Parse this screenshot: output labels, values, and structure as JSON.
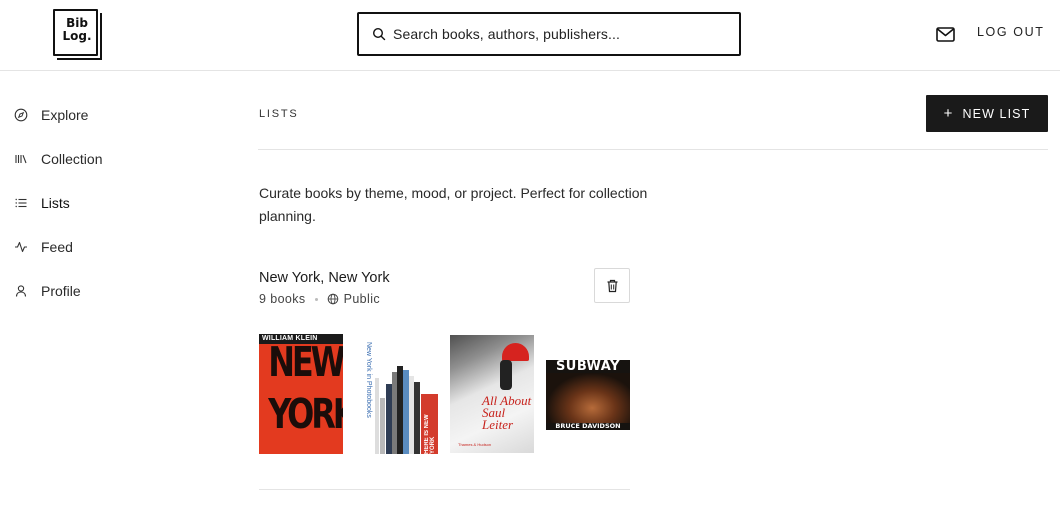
{
  "header": {
    "logo_line1": "Bib",
    "logo_line2": "Log.",
    "search_placeholder": "Search books, authors, publishers...",
    "messages_icon": "mail-icon",
    "logout_label": "LOG OUT"
  },
  "sidebar": {
    "items": [
      {
        "label": "Explore",
        "icon": "compass-icon"
      },
      {
        "label": "Collection",
        "icon": "library-icon"
      },
      {
        "label": "Lists",
        "icon": "list-icon",
        "active": true
      },
      {
        "label": "Feed",
        "icon": "activity-icon"
      },
      {
        "label": "Profile",
        "icon": "user-icon"
      }
    ]
  },
  "main": {
    "title": "LISTS",
    "new_list_label": "NEW LIST",
    "description": "Curate books by theme, mood, or project. Perfect for collection planning.",
    "lists": [
      {
        "name": "New York, New York",
        "count": "9 books",
        "visibility": "Public",
        "covers": [
          {
            "top_text": "WILLIAM KLEIN",
            "title": "NEW YORK"
          },
          {
            "spine_text": "New York in Photobooks",
            "spine_text_2": "HERE IS NEW YORK"
          },
          {
            "title": "All About Saul Leiter",
            "publisher": "Thames & Hudson"
          },
          {
            "title": "SUBWAY",
            "author": "BRUCE DAVIDSON"
          }
        ]
      }
    ]
  }
}
